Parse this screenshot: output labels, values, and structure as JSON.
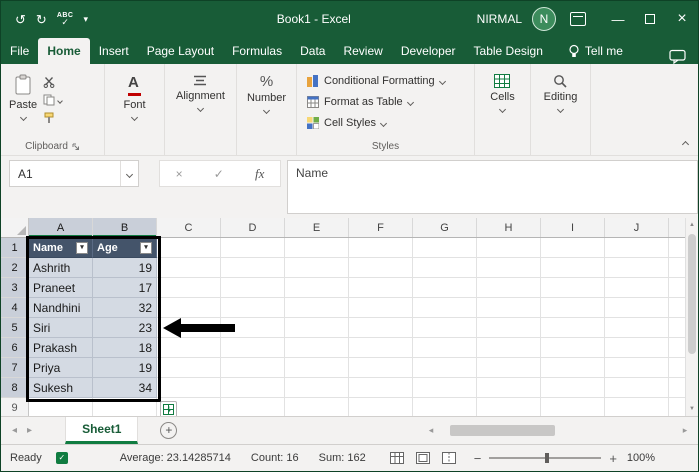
{
  "window": {
    "title": "Book1 - Excel",
    "user": "NIRMAL",
    "avatar_initial": "N"
  },
  "icons": {
    "undo": "↺",
    "redo": "↻",
    "spelling_abc": "ABC",
    "spelling_check": "✓",
    "qat_dropdown": "▾",
    "minimize": "—",
    "close": "×",
    "dropdown": "▾",
    "cancel": "×",
    "enter": "✓",
    "nav_left": "◂",
    "nav_right": "▸",
    "new_sheet": "+",
    "scroll_up": "▲",
    "scroll_down": "▼",
    "scroll_left": "◂",
    "scroll_right": "▸",
    "zoom_out": "−",
    "zoom_in": "+",
    "accessibility_check": "✓"
  },
  "ribbon": {
    "tabs": [
      "File",
      "Home",
      "Insert",
      "Page Layout",
      "Formulas",
      "Data",
      "Review",
      "Developer",
      "Table Design"
    ],
    "active_tab": "Home",
    "tell_me": "Tell me",
    "clipboard": {
      "label": "Clipboard",
      "paste": "Paste"
    },
    "font": {
      "label": "Font",
      "big_a": "A"
    },
    "alignment": {
      "label": "Alignment"
    },
    "number": {
      "label": "Number",
      "percent": "%"
    },
    "styles": {
      "label": "Styles",
      "conditional_formatting": "Conditional Formatting",
      "format_as_table": "Format as Table",
      "cell_styles": "Cell Styles"
    },
    "cells": {
      "label": "Cells"
    },
    "editing": {
      "label": "Editing"
    }
  },
  "formula_bar": {
    "name_box": "A1",
    "fx": "fx",
    "content": "Name"
  },
  "grid": {
    "columns": [
      "A",
      "B",
      "C",
      "D",
      "E",
      "F",
      "G",
      "H",
      "I",
      "J"
    ],
    "selected_columns": [
      "A",
      "B"
    ],
    "row_count": 9,
    "selected_rows": [
      1,
      2,
      3,
      4,
      5,
      6,
      7,
      8
    ],
    "table": {
      "headers": [
        "Name",
        "Age"
      ],
      "rows": [
        [
          "Ashrith",
          "19"
        ],
        [
          "Praneet",
          "17"
        ],
        [
          "Nandhini",
          "32"
        ],
        [
          "Siri",
          "23"
        ],
        [
          "Prakash",
          "18"
        ],
        [
          "Priya",
          "19"
        ],
        [
          "Sukesh",
          "34"
        ]
      ]
    }
  },
  "sheet_bar": {
    "active_tab": "Sheet1"
  },
  "status_bar": {
    "mode": "Ready",
    "average": "Average: 23.14285714",
    "count": "Count: 16",
    "sum": "Sum: 162",
    "zoom": "100%"
  },
  "colors": {
    "title_bar": "#185C37",
    "accent_green": "#107C41",
    "table_header": "#44546A",
    "selection_fill": "#D4DAE3",
    "selection_header": "#C9CFD9",
    "annotation": "#000000"
  }
}
